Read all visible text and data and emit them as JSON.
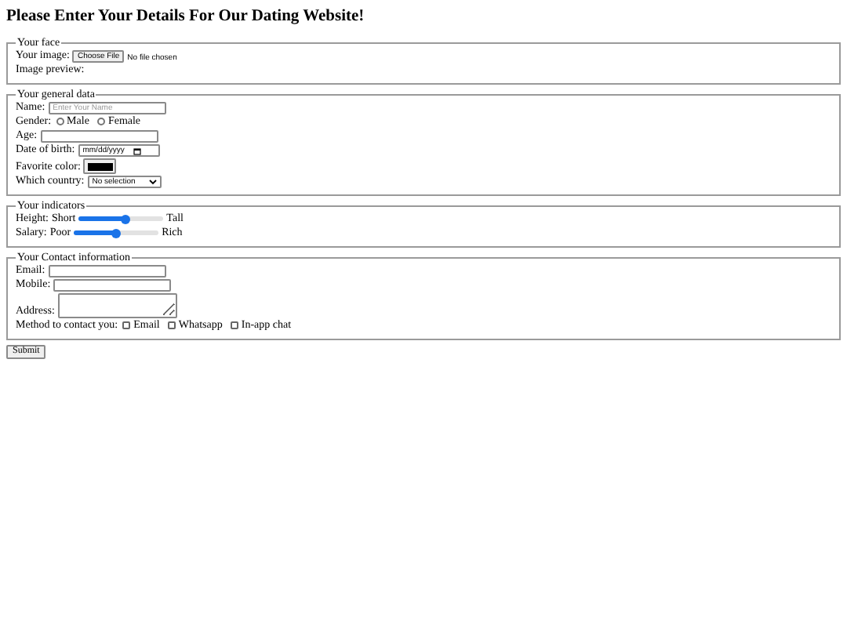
{
  "title": "Please Enter Your Details For Our Dating Website!",
  "sections": [
    {
      "legend": "Your face",
      "rows": [
        {
          "kind": "file",
          "label": "Your image:",
          "button": "Choose File",
          "status": "No file chosen"
        },
        {
          "kind": "label",
          "label": "Image preview:"
        }
      ]
    },
    {
      "legend": "Your general data",
      "rows": [
        {
          "kind": "text",
          "label": "Name:",
          "placeholder": "Enter Your Name"
        },
        {
          "kind": "radio",
          "label": "Gender:",
          "options": [
            {
              "label": "Male",
              "selected": false
            },
            {
              "label": "Female",
              "selected": false
            }
          ]
        },
        {
          "kind": "text",
          "label": "Age:"
        },
        {
          "kind": "date",
          "label": "Date of birth:",
          "value": "mm/dd/yyyy"
        },
        {
          "kind": "color",
          "label": "Favorite color:",
          "color": "#000000"
        },
        {
          "kind": "select",
          "label": "Which country:",
          "value": "No selection"
        }
      ]
    },
    {
      "legend": "Your indicators",
      "rows": [
        {
          "kind": "range",
          "label": "Height:",
          "min_label": "Short",
          "max_label": "Tall",
          "level": 0.55
        },
        {
          "kind": "range",
          "label": "Salary:",
          "min_label": "Poor",
          "max_label": "Rich",
          "level": 0.5
        }
      ]
    },
    {
      "legend": "Your Contact information",
      "rows": [
        {
          "kind": "text",
          "label": "Email:"
        },
        {
          "kind": "text",
          "label": "Mobile:"
        },
        {
          "kind": "textarea",
          "label": "Address:"
        },
        {
          "kind": "checks",
          "label": "Method to contact you:",
          "options": [
            {
              "label": "Email",
              "checked": false
            },
            {
              "label": "Whatsapp",
              "checked": false
            },
            {
              "label": "In-app chat",
              "checked": false
            }
          ]
        }
      ]
    }
  ],
  "submit": "Submit"
}
